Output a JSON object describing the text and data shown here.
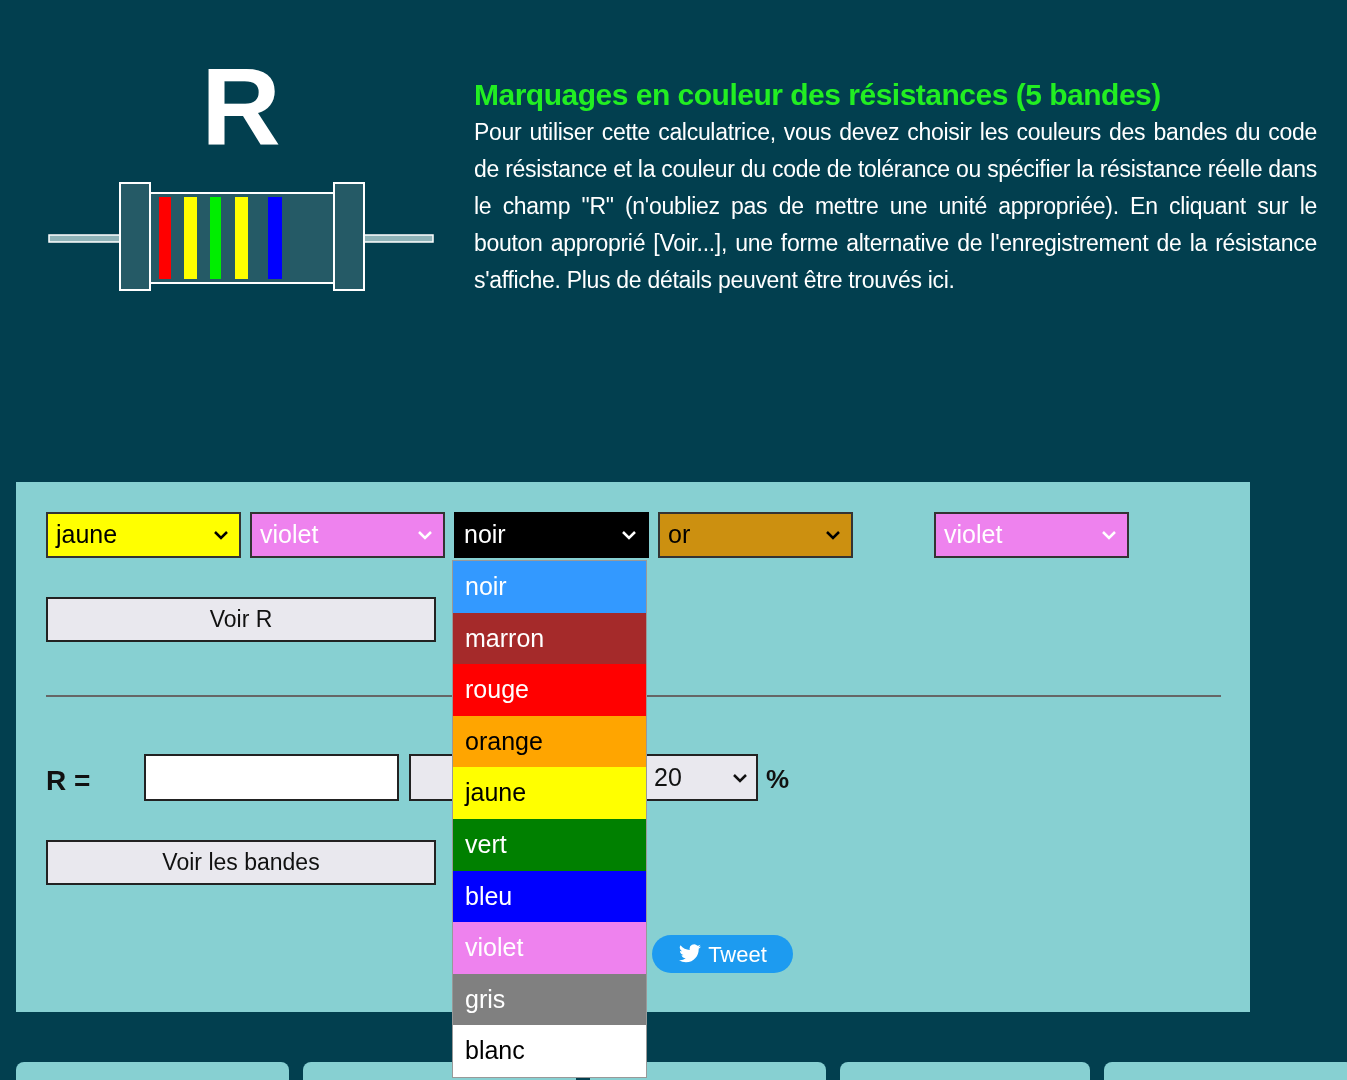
{
  "logo": {
    "letter": "R"
  },
  "intro": {
    "title": "Marquages en couleur des résistances (5 bandes)",
    "text": "Pour utiliser cette calculatrice, vous devez choisir les couleurs des bandes du code de résistance et la couleur du code de tolérance ou spécifier la résistance réelle dans le champ \"R\" (n'oubliez pas de mettre une unité appropriée). En cliquant sur le bouton approprié [Voir...], une forme alternative de l'enregistrement de la résistance s'affiche. Plus de détails peuvent être trouvés ici."
  },
  "band_selects": [
    {
      "value": "jaune",
      "color": "#ffff00",
      "kind": "dark",
      "expanded": false
    },
    {
      "value": "violet",
      "color": "#ee82ee",
      "kind": "light",
      "expanded": false
    },
    {
      "value": "noir",
      "color": "#000000",
      "kind": "light",
      "expanded": true
    },
    {
      "value": "or",
      "color": "#cc9010",
      "kind": "dark",
      "expanded": false
    },
    {
      "value": "violet",
      "color": "#ee82ee",
      "kind": "light",
      "expanded": false
    }
  ],
  "dropdown_options": [
    {
      "label": "noir",
      "kind": "light",
      "selected": true
    },
    {
      "label": "marron",
      "color": "#a52a2a",
      "kind": "light",
      "selected": false
    },
    {
      "label": "rouge",
      "color": "#ff0000",
      "kind": "light",
      "selected": false
    },
    {
      "label": "orange",
      "color": "#ffa500",
      "kind": "dark",
      "selected": false
    },
    {
      "label": "jaune",
      "color": "#ffff00",
      "kind": "dark",
      "selected": false
    },
    {
      "label": "vert",
      "color": "#008000",
      "kind": "light",
      "selected": false
    },
    {
      "label": "bleu",
      "color": "#0000ff",
      "kind": "light",
      "selected": false
    },
    {
      "label": "violet",
      "color": "#ee82ee",
      "kind": "light",
      "selected": false
    },
    {
      "label": "gris",
      "color": "#808080",
      "kind": "light",
      "selected": false
    },
    {
      "label": "blanc",
      "color": "#ffffff",
      "kind": "dark",
      "selected": false
    }
  ],
  "buttons": {
    "show_r": "Voir R",
    "show_bands": "Voir les bandes",
    "tweet": "Tweet"
  },
  "r_row": {
    "label": "R =",
    "tolerance": "20",
    "percent": "%"
  }
}
